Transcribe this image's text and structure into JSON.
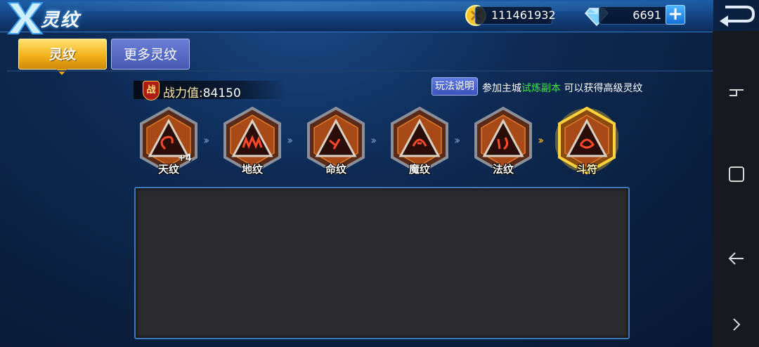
{
  "header": {
    "title": "灵纹"
  },
  "currency": {
    "gold": "111461932",
    "gems": "6691",
    "plus_label": "+"
  },
  "tabs": [
    {
      "label": "灵纹",
      "active": true
    },
    {
      "label": "更多灵纹",
      "active": false
    }
  ],
  "power": {
    "badge": "战",
    "label": "战力值:",
    "value": "84150"
  },
  "rules_button": "玩法说明",
  "hint": {
    "prefix": "参加主城",
    "highlight": "试炼副本",
    "suffix": "可以获得高级灵纹"
  },
  "runes": [
    {
      "name": "天纹",
      "level": "+4",
      "selected": false
    },
    {
      "name": "地纹",
      "level": "",
      "selected": false
    },
    {
      "name": "命纹",
      "level": "",
      "selected": false
    },
    {
      "name": "魔纹",
      "level": "",
      "selected": false
    },
    {
      "name": "法纹",
      "level": "",
      "selected": false
    },
    {
      "name": "斗符",
      "level": "",
      "selected": true
    }
  ],
  "colors": {
    "accent_gold": "#f2b11c",
    "tab_inactive": "#4658b3",
    "highlight_green": "#3de83b",
    "panel_border": "#3f78b8"
  }
}
